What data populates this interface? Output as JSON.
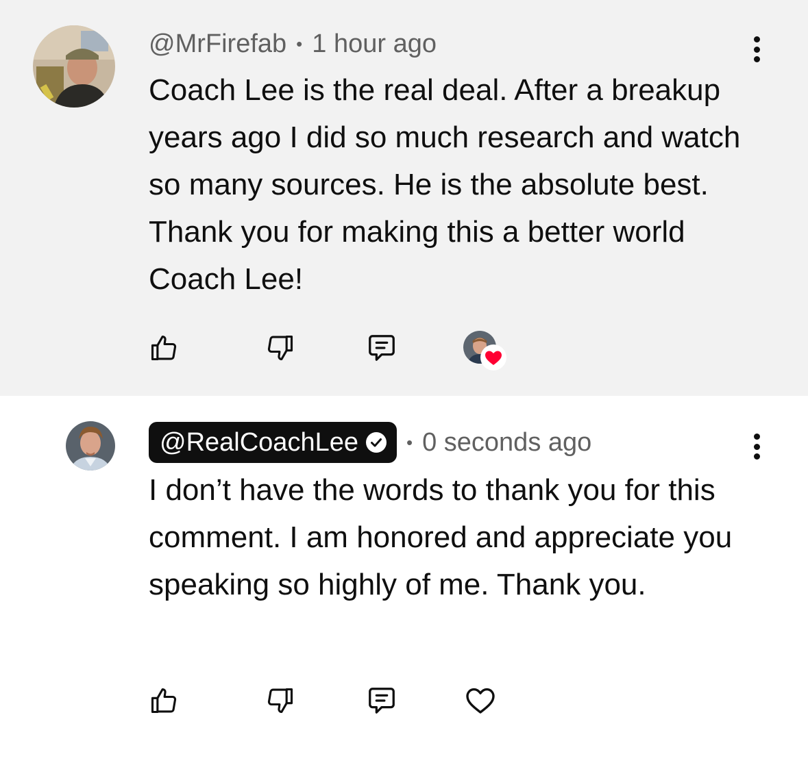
{
  "comments": [
    {
      "handle": "@MrFirefab",
      "separator": "•",
      "time": "1 hour ago",
      "text": "Coach Lee is the real deal. After a breakup years ago I did so much research and watch so many sources. He is the absolute best. Thank you for making this a better world Coach Lee!",
      "hearted_by_creator": true,
      "avatar_icon": "user-avatar-photo"
    },
    {
      "handle": "@RealCoachLee",
      "verified": true,
      "separator": "•",
      "time": "0 seconds ago",
      "text": "I don’t have the words to thank you for this comment. I am honored and appreciate you speaking so highly of me. Thank you.",
      "hearted_by_creator": false,
      "avatar_icon": "creator-avatar-photo"
    }
  ],
  "icons": {
    "like": "thumbs-up-icon",
    "dislike": "thumbs-down-icon",
    "reply": "reply-comment-icon",
    "heart": "heart-icon",
    "more": "more-vertical-icon",
    "verified": "verified-check-icon"
  },
  "colors": {
    "highlight_background": "#f2f2f2",
    "text_primary": "#0f0f0f",
    "text_secondary": "#606060",
    "heart_red": "#ff0033",
    "owner_pill": "#0f0f0f"
  }
}
